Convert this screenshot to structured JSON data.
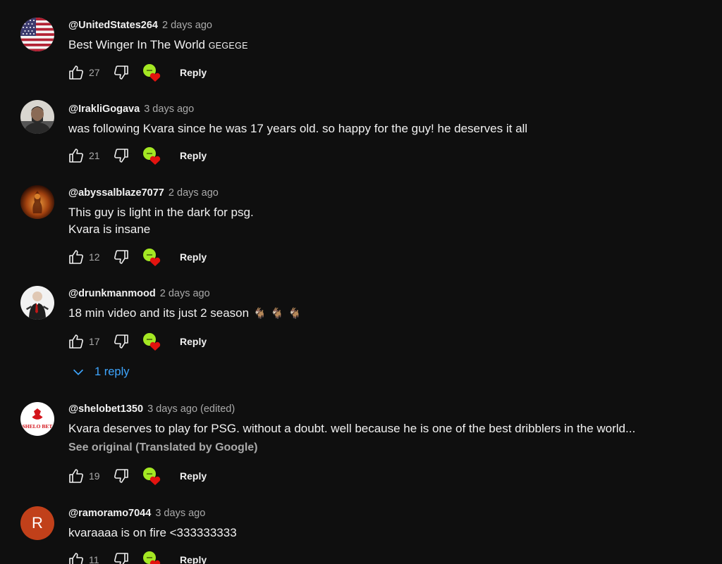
{
  "colors": {
    "background": "#0f0f0f",
    "text_primary": "#f1f1f1",
    "text_secondary": "#aaaaaa",
    "link": "#3ea6ff",
    "heart": "#e3130f",
    "creator_badge": "#a4e823",
    "avatar_r": "#c1401a"
  },
  "comments": [
    {
      "author": "@UnitedStates264",
      "time": "2 days ago",
      "text": "Best Winger In The World",
      "text_suffix": "GEGEGE",
      "likes": "27",
      "reply_label": "Reply",
      "avatar_icon": "us-flag-avatar"
    },
    {
      "author": "@IrakliGogava",
      "time": "3 days ago",
      "text": "was following Kvara since he was 17 years old. so happy for the guy! he deserves it all",
      "likes": "21",
      "reply_label": "Reply",
      "avatar_icon": "profile-photo-avatar"
    },
    {
      "author": "@abyssalblaze7077",
      "time": "2 days ago",
      "text": "This guy is light in the dark for psg.\nKvara is insane",
      "likes": "12",
      "reply_label": "Reply",
      "avatar_icon": "fire-figure-avatar"
    },
    {
      "author": "@drunkmanmood",
      "time": "2 days ago",
      "text": "18 min video and its just 2 season",
      "emojis": [
        "🐐",
        "🐐",
        "🐐"
      ],
      "likes": "17",
      "reply_label": "Reply",
      "replies_label": "1 reply",
      "avatar_icon": "hitman-avatar"
    },
    {
      "author": "@shelobet1350",
      "time": "3 days ago (edited)",
      "text": "Kvara deserves to play for PSG. without a doubt. well because he is one of the best dribblers in the world...",
      "see_original": "See original (Translated by Google)",
      "likes": "19",
      "reply_label": "Reply",
      "avatar_icon": "shelo-bet-logo-avatar",
      "avatar_text": "SHELO BET"
    },
    {
      "author": "@ramoramo7044",
      "time": "3 days ago",
      "text": "kvaraaaa is on fire <333333333",
      "likes": "11",
      "reply_label": "Reply",
      "avatar_icon": "letter-avatar",
      "avatar_letter": "R"
    }
  ]
}
